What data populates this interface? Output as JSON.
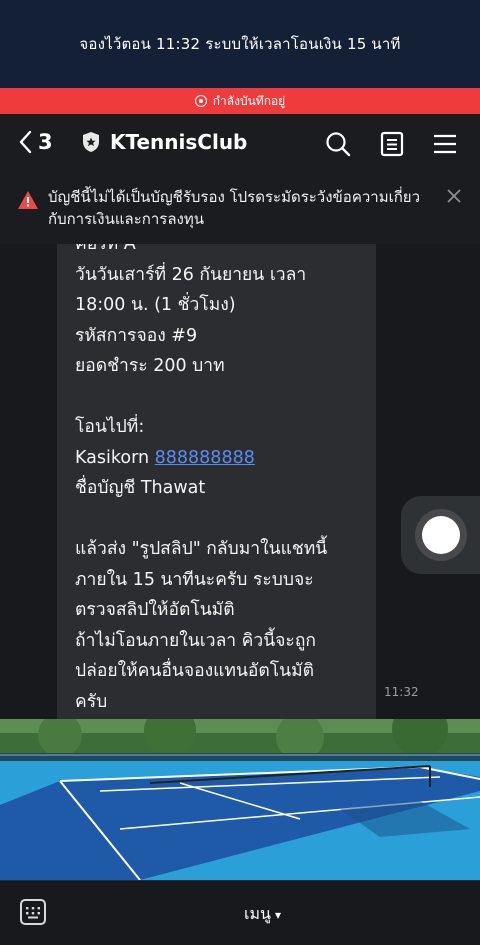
{
  "top_banner": {
    "text": "จองไว้ตอน 11:32 ระบบให้เวลาโอนเงิน 15 นาที"
  },
  "recording": {
    "text": "กำลังบันทึกอยู่"
  },
  "header": {
    "back_count": "3",
    "title": "KTennisClub",
    "icons": [
      "search-icon",
      "note-icon",
      "menu-icon"
    ]
  },
  "warning": {
    "text": "บัญชีนี้ไม่ได้เป็นบัญชีรับรอง โปรดระมัดระวังข้อความเกี่ยวกับการเงินและการลงทุน"
  },
  "message": {
    "line_partial": "คอร์ท A",
    "line1": "วันวันเสาร์ที่ 26 กันยายน เวลา",
    "line2": "18:00 น. (1 ชั่วโมง)",
    "line3": "รหัสการจอง #9",
    "line4": "ยอดชำระ 200 บาท",
    "line5": "โอนไปที่:",
    "bank": "Kasikorn ",
    "account_number": "888888888",
    "account_name": "ชื่อบัญชี Thawat",
    "line6": "แล้วส่ง \"รูปสลิป\" กลับมาในแชทนี้",
    "line7": "ภายใน 15 นาทีนะครับ ระบบจะ",
    "line8": "ตรวจสลิปให้อัตโนมัติ",
    "line9": "ถ้าไม่โอนภายในเวลา คิวนี้จะถูก",
    "line10": "ปล่อยให้คนอื่นจองแทนอัตโนมัติ",
    "line11": "ครับ",
    "time": "11:32"
  },
  "bottom": {
    "menu_label": "เมนู",
    "menu_arrow": "▾"
  },
  "colors": {
    "banner": "#142035",
    "recording": "#ef3b3b",
    "link": "#5b8cf2",
    "court_blue": "#2a9fd8"
  }
}
